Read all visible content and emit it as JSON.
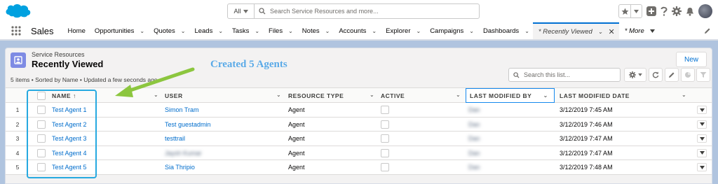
{
  "header": {
    "search_scope": "All",
    "search_placeholder": "Search Service Resources and more..."
  },
  "nav": {
    "app_name": "Sales",
    "items": [
      {
        "label": "Home",
        "has_menu": false
      },
      {
        "label": "Opportunities",
        "has_menu": true
      },
      {
        "label": "Quotes",
        "has_menu": true
      },
      {
        "label": "Leads",
        "has_menu": true
      },
      {
        "label": "Tasks",
        "has_menu": true
      },
      {
        "label": "Files",
        "has_menu": true
      },
      {
        "label": "Notes",
        "has_menu": true
      },
      {
        "label": "Accounts",
        "has_menu": true
      },
      {
        "label": "Explorer",
        "has_menu": true
      },
      {
        "label": "Campaigns",
        "has_menu": true
      },
      {
        "label": "Dashboards",
        "has_menu": true
      }
    ],
    "active_tab": "* Recently Viewed",
    "more_label": "* More"
  },
  "list": {
    "object_type": "Service Resources",
    "title": "Recently Viewed",
    "meta": "5 items • Sorted by Name • Updated a few seconds ago",
    "new_button": "New",
    "search_placeholder": "Search this list..."
  },
  "table": {
    "columns": {
      "name": "NAME",
      "sort_indicator": "↑",
      "user": "USER",
      "resource_type": "RESOURCE TYPE",
      "active": "ACTIVE",
      "last_modified_by": "LAST MODIFIED BY",
      "last_modified_date": "LAST MODIFIED DATE"
    },
    "rows": [
      {
        "num": "1",
        "name": "Test Agent 1",
        "user": "Simon Tram",
        "user_blurred": false,
        "resource_type": "Agent",
        "modified_by": "Dan",
        "modified_date": "3/12/2019 7:45 AM"
      },
      {
        "num": "2",
        "name": "Test Agent 2",
        "user": "Test guestadmin",
        "user_blurred": false,
        "resource_type": "Agent",
        "modified_by": "Dan",
        "modified_date": "3/12/2019 7:46 AM"
      },
      {
        "num": "3",
        "name": "Test Agent 3",
        "user": "testtrail",
        "user_blurred": false,
        "resource_type": "Agent",
        "modified_by": "Dan",
        "modified_date": "3/12/2019 7:47 AM"
      },
      {
        "num": "4",
        "name": "Test Agent 4",
        "user": "Jaysh Kumar",
        "user_blurred": true,
        "resource_type": "Agent",
        "modified_by": "Dan",
        "modified_date": "3/12/2019 7:47 AM"
      },
      {
        "num": "5",
        "name": "Test Agent 5",
        "user": "Sia Thripio",
        "user_blurred": false,
        "resource_type": "Agent",
        "modified_by": "Dan",
        "modified_date": "3/12/2019 7:48 AM"
      }
    ]
  },
  "annotation": {
    "text": "Created 5 Agents",
    "color": "#5aa9e6",
    "box_color": "#26a9e0",
    "arrow_color": "#8cc63f"
  }
}
